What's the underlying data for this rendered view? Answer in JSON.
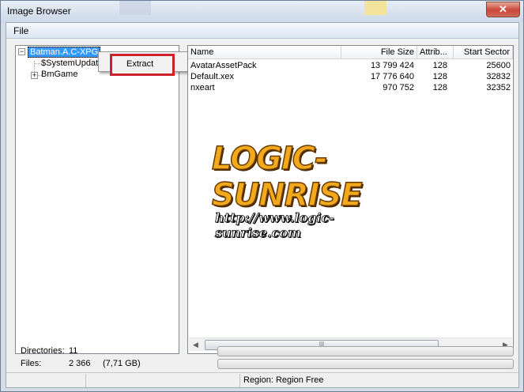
{
  "window": {
    "title": "Image Browser",
    "close_glyph": "✕"
  },
  "menu": {
    "file": "File"
  },
  "tree": {
    "root": {
      "label": "Batman.A.C-XPG",
      "expander": "−"
    },
    "children": [
      {
        "label": "$SystemUpdat"
      },
      {
        "label": "BmGame",
        "expander": "+"
      }
    ]
  },
  "context_menu": {
    "extract": "Extract"
  },
  "list": {
    "columns": [
      "Name",
      "File Size",
      "Attrib...",
      "Start Sector"
    ],
    "rows": [
      {
        "name": "AvatarAssetPack",
        "size": "13 799 424",
        "attrib": "128",
        "sector": "25600"
      },
      {
        "name": "Default.xex",
        "size": "17 776 640",
        "attrib": "128",
        "sector": "32832"
      },
      {
        "name": "nxeart",
        "size": "970 752",
        "attrib": "128",
        "sector": "32352"
      }
    ]
  },
  "watermark": {
    "brand": "LOGIC-SUNRISE",
    "url": "http://www.logic-sunrise.com"
  },
  "stats": {
    "directories_label": "Directories:",
    "directories_value": "11",
    "files_label": "Files:",
    "files_value": "2 366",
    "files_size": "(7,71 GB)"
  },
  "statusbar": {
    "region": "Region: Region Free"
  },
  "colors": {
    "selection": "#3399ff",
    "highlight_box": "#d0202b",
    "brand_orange": "#f2a91b"
  }
}
